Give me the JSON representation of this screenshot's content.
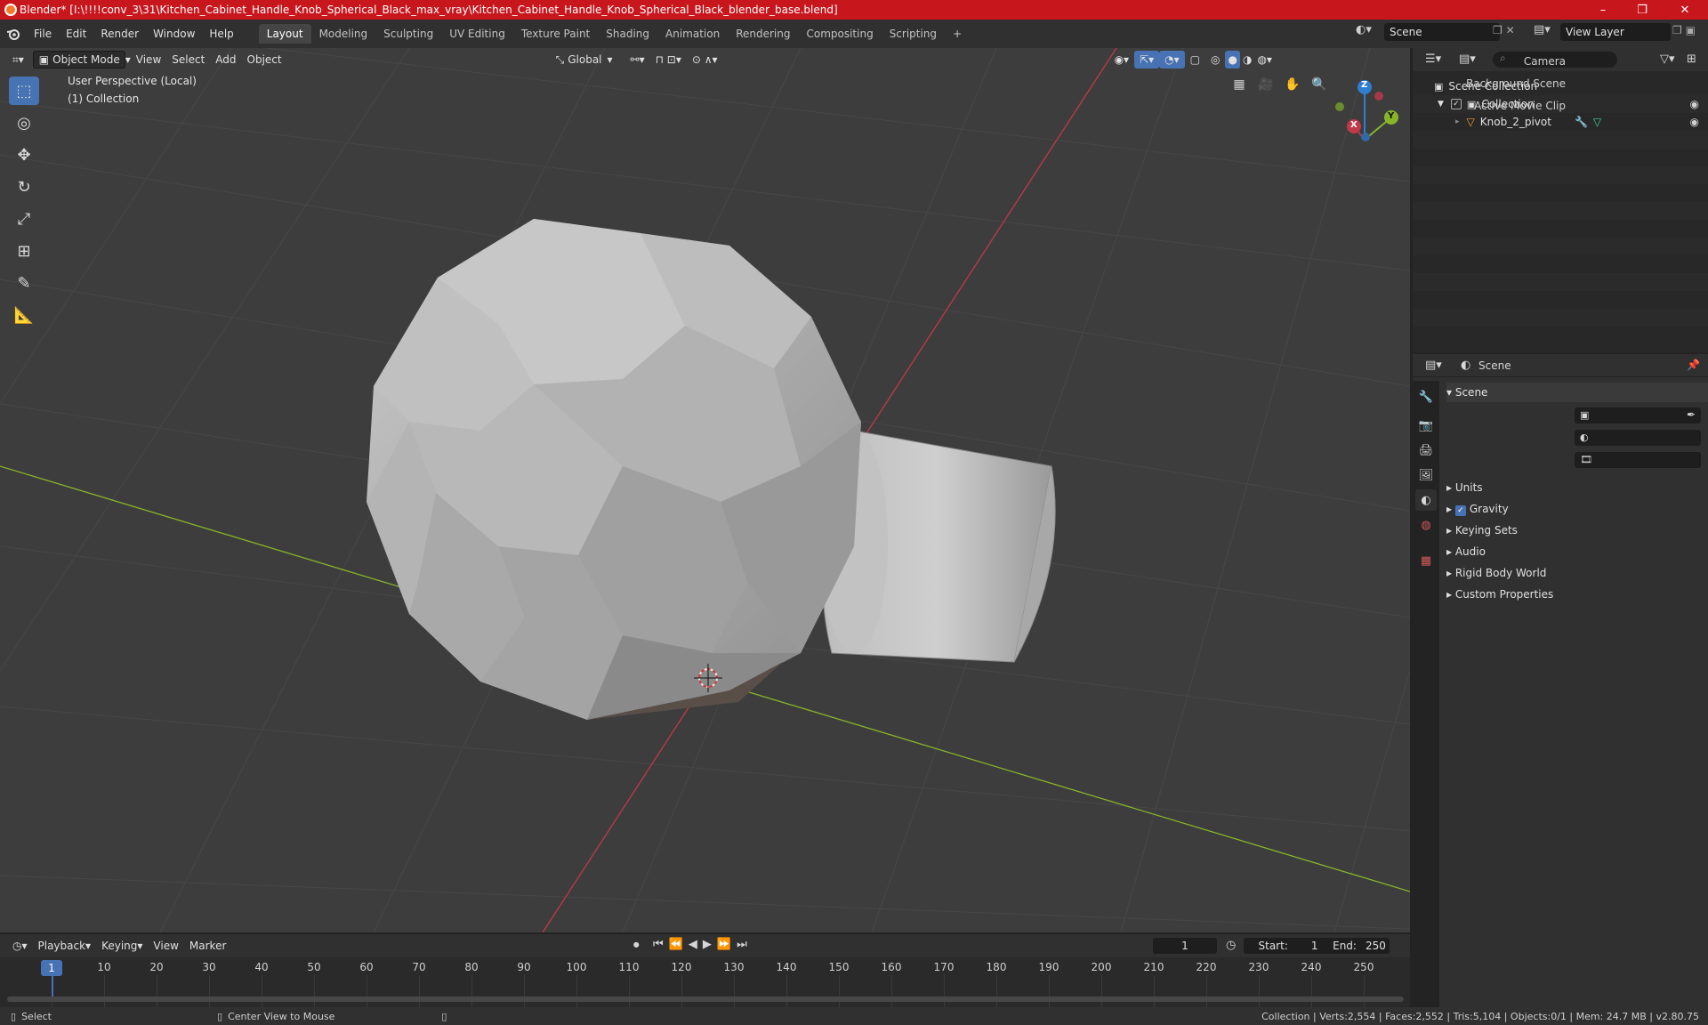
{
  "window": {
    "title": "Blender* [I:\\!!!!conv_3\\31\\Kitchen_Cabinet_Handle_Knob_Spherical_Black_max_vray\\Kitchen_Cabinet_Handle_Knob_Spherical_Black_blender_base.blend]",
    "minimize": "–",
    "restore": "❐",
    "close": "✕"
  },
  "menu": {
    "items": [
      "File",
      "Edit",
      "Render",
      "Window",
      "Help"
    ],
    "workspaces": [
      "Layout",
      "Modeling",
      "Sculpting",
      "UV Editing",
      "Texture Paint",
      "Shading",
      "Animation",
      "Rendering",
      "Compositing",
      "Scripting"
    ],
    "add_tab": "+",
    "scene": "Scene",
    "view_layer": "View Layer"
  },
  "viewport": {
    "mode": "Object Mode",
    "menus": [
      "View",
      "Select",
      "Add",
      "Object"
    ],
    "transform_orientation": "Global",
    "info_line1": "User Perspective (Local)",
    "info_line2": "(1) Collection",
    "gizmo": {
      "z": "Z",
      "y": "Y",
      "x": "X"
    },
    "colors": {
      "bg": "#3d3d3d",
      "x_axis": "#c0394a",
      "y_axis": "#88b42a",
      "z_axis": "#2f7fd0",
      "active": "#4772b3"
    }
  },
  "outliner": {
    "search_placeholder": "",
    "root": "Scene Collection",
    "collection": "Collection",
    "object": "Knob_2_pivot"
  },
  "properties": {
    "header": "Scene",
    "section": "Scene",
    "camera_label": "Camera",
    "bg_scene_label": "Background Scene",
    "movie_clip_label": "Active Movie Clip",
    "sections": [
      "Units",
      "Gravity",
      "Keying Sets",
      "Audio",
      "Rigid Body World",
      "Custom Properties"
    ]
  },
  "timeline": {
    "menus": [
      "Playback",
      "Keying",
      "View",
      "Marker"
    ],
    "current_frame": "1",
    "start_label": "Start:",
    "start": "1",
    "end_label": "End:",
    "end": "250",
    "ticks": [
      "1",
      "10",
      "20",
      "30",
      "40",
      "50",
      "60",
      "70",
      "80",
      "90",
      "100",
      "110",
      "120",
      "130",
      "140",
      "150",
      "160",
      "170",
      "180",
      "190",
      "200",
      "210",
      "220",
      "230",
      "240",
      "250"
    ]
  },
  "status": {
    "select": "Select",
    "center": "Center View to Mouse",
    "stats": "Collection | Verts:2,554 | Faces:2,552 | Tris:5,104 | Objects:0/1 | Mem: 24.7 MB | v2.80.75"
  }
}
